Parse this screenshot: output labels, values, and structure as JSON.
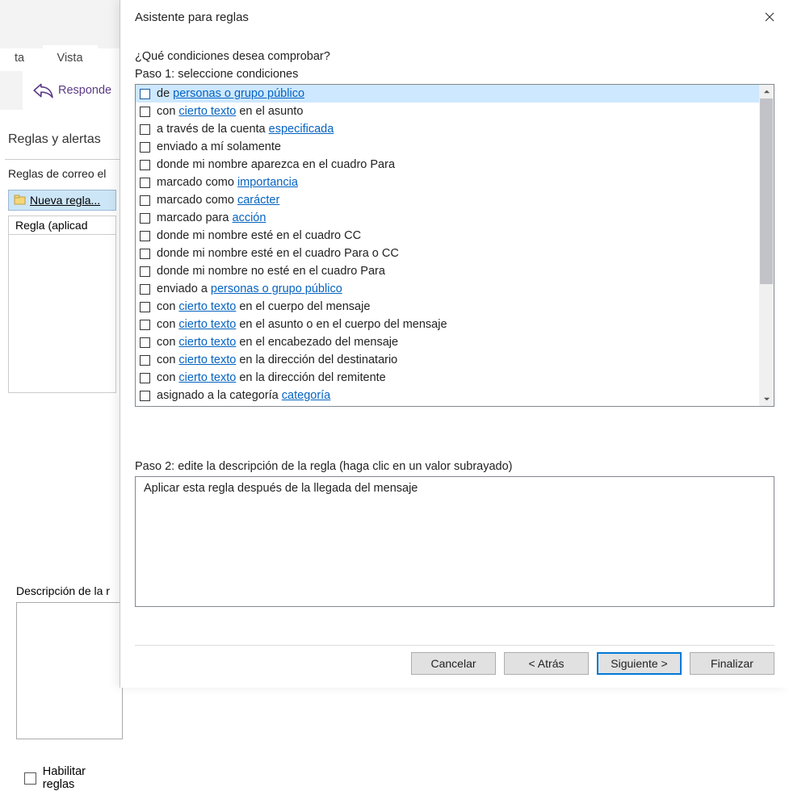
{
  "bg": {
    "tab1": "ta",
    "tab2": "Vista",
    "reply": "Responde",
    "rules_title": "Reglas y alertas",
    "rules_header": "Reglas de correo el",
    "new_rule": "Nueva regla...",
    "rule_col": "Regla (aplicad",
    "desc_label": "Descripción de la r",
    "enable_label": "Habilitar reglas"
  },
  "modal": {
    "title": "Asistente para reglas",
    "question": "¿Qué condiciones desea comprobar?",
    "step1": "Paso 1: seleccione condiciones",
    "step2": "Paso 2: edite la descripción de la regla (haga clic en un valor subrayado)",
    "description": "Aplicar esta regla después de la llegada del mensaje",
    "buttons": {
      "cancel": "Cancelar",
      "back": "< Atrás",
      "next": "Siguiente >",
      "finish": "Finalizar"
    }
  },
  "conditions": [
    {
      "selected": true,
      "parts": [
        {
          "t": "de "
        },
        {
          "t": "personas o grupo público",
          "link": true
        }
      ]
    },
    {
      "selected": false,
      "parts": [
        {
          "t": "con "
        },
        {
          "t": "cierto texto",
          "link": true
        },
        {
          "t": " en el asunto"
        }
      ]
    },
    {
      "selected": false,
      "parts": [
        {
          "t": "a través de la cuenta "
        },
        {
          "t": "especificada",
          "link": true
        }
      ]
    },
    {
      "selected": false,
      "parts": [
        {
          "t": "enviado a mí solamente"
        }
      ]
    },
    {
      "selected": false,
      "parts": [
        {
          "t": "donde mi nombre aparezca en el cuadro Para"
        }
      ]
    },
    {
      "selected": false,
      "parts": [
        {
          "t": "marcado como "
        },
        {
          "t": "importancia",
          "link": true
        }
      ]
    },
    {
      "selected": false,
      "parts": [
        {
          "t": "marcado como "
        },
        {
          "t": "carácter",
          "link": true
        }
      ]
    },
    {
      "selected": false,
      "parts": [
        {
          "t": "marcado para "
        },
        {
          "t": "acción",
          "link": true
        }
      ]
    },
    {
      "selected": false,
      "parts": [
        {
          "t": "donde mi nombre esté en el cuadro CC"
        }
      ]
    },
    {
      "selected": false,
      "parts": [
        {
          "t": "donde mi nombre esté en el cuadro Para o CC"
        }
      ]
    },
    {
      "selected": false,
      "parts": [
        {
          "t": "donde mi nombre no esté en el cuadro Para"
        }
      ]
    },
    {
      "selected": false,
      "parts": [
        {
          "t": "enviado a "
        },
        {
          "t": "personas o grupo público",
          "link": true
        }
      ]
    },
    {
      "selected": false,
      "parts": [
        {
          "t": "con "
        },
        {
          "t": "cierto texto",
          "link": true
        },
        {
          "t": " en el cuerpo del mensaje"
        }
      ]
    },
    {
      "selected": false,
      "parts": [
        {
          "t": "con "
        },
        {
          "t": "cierto texto",
          "link": true
        },
        {
          "t": " en el asunto o en el cuerpo del mensaje"
        }
      ]
    },
    {
      "selected": false,
      "parts": [
        {
          "t": "con "
        },
        {
          "t": "cierto texto",
          "link": true
        },
        {
          "t": " en el encabezado del mensaje"
        }
      ]
    },
    {
      "selected": false,
      "parts": [
        {
          "t": "con "
        },
        {
          "t": "cierto texto",
          "link": true
        },
        {
          "t": " en la dirección del destinatario"
        }
      ]
    },
    {
      "selected": false,
      "parts": [
        {
          "t": "con "
        },
        {
          "t": "cierto texto",
          "link": true
        },
        {
          "t": " en la dirección del remitente"
        }
      ]
    },
    {
      "selected": false,
      "parts": [
        {
          "t": "asignado a la categoría "
        },
        {
          "t": "categoría",
          "link": true
        }
      ]
    }
  ]
}
